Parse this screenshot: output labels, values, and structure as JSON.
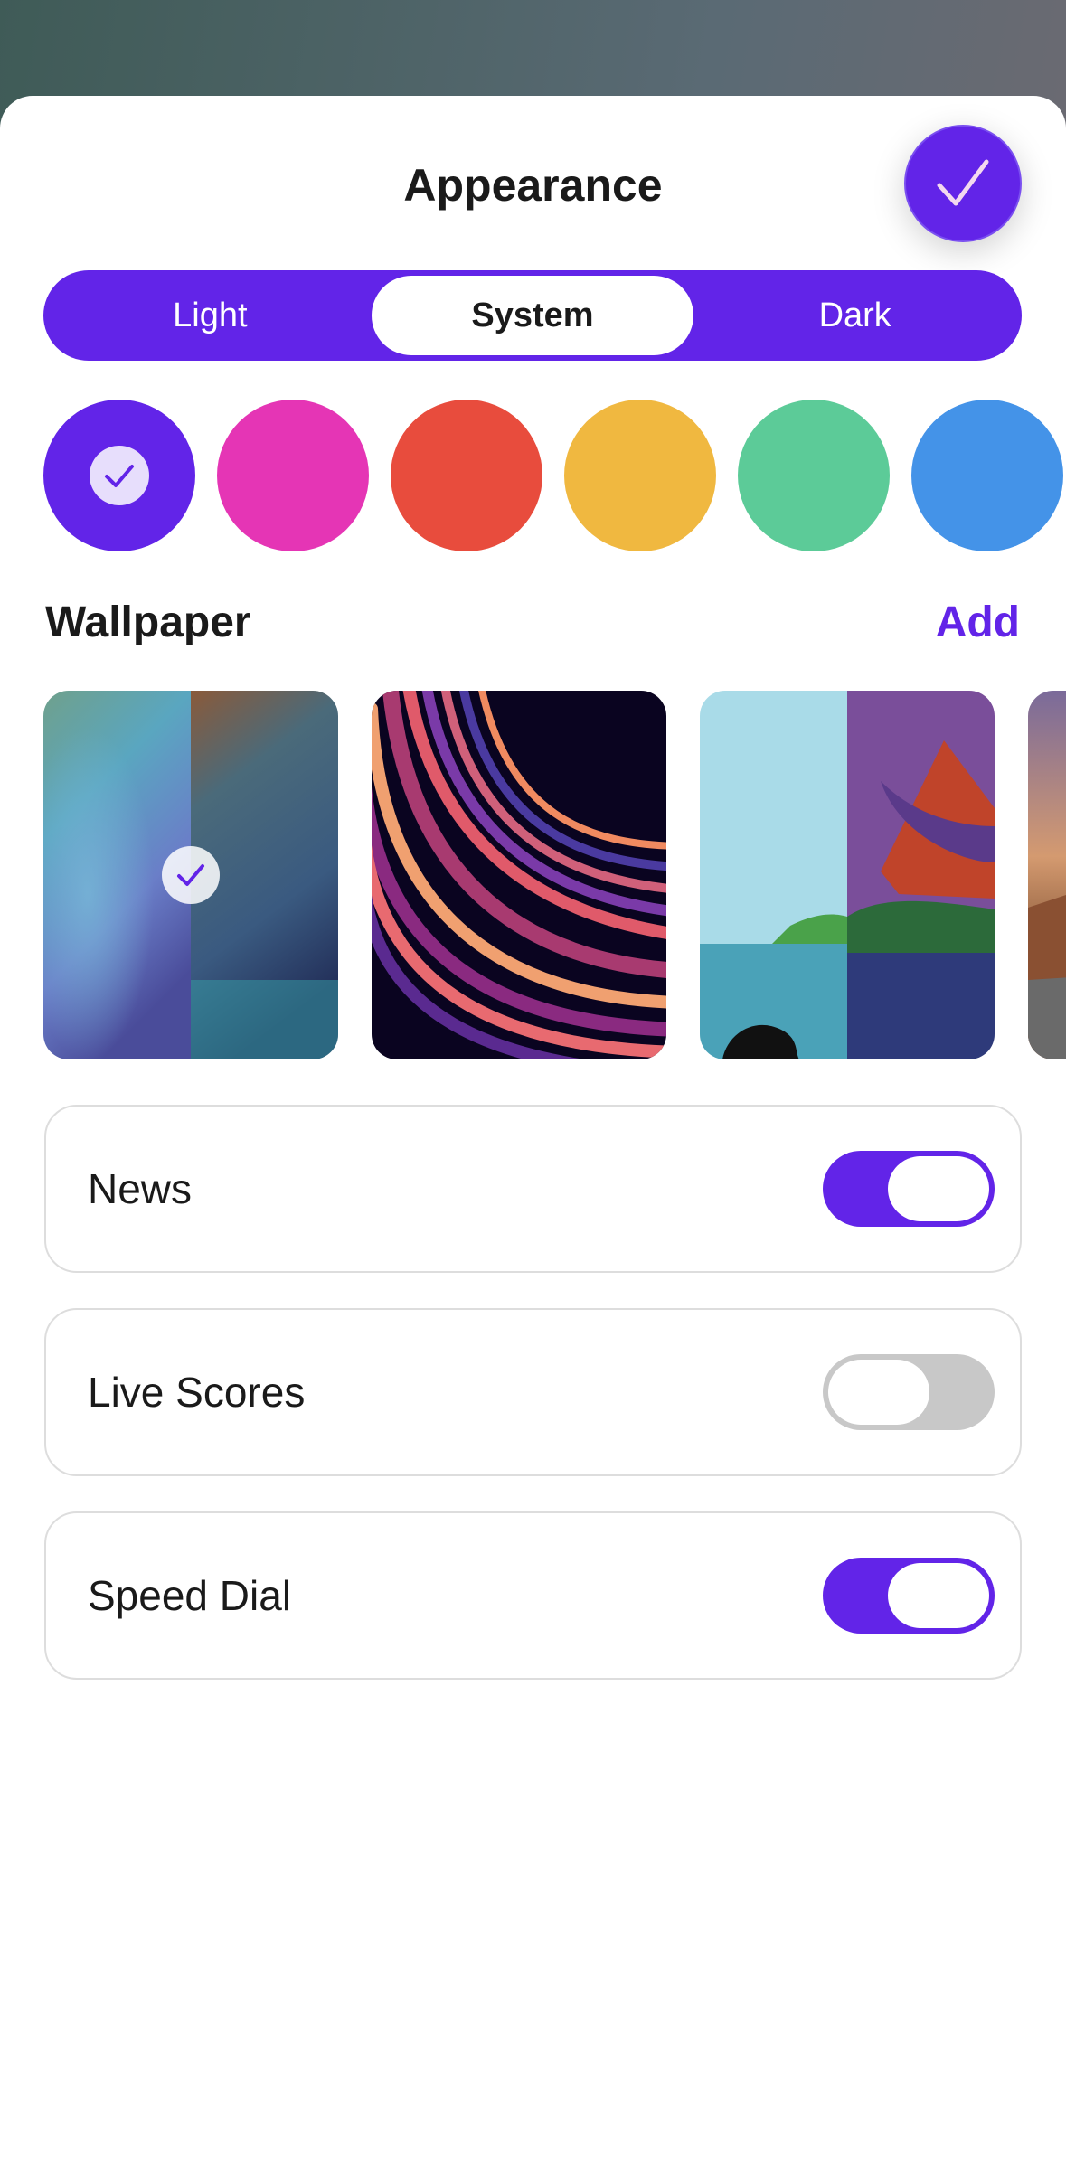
{
  "header": {
    "title": "Appearance",
    "done_icon": "checkmark-icon"
  },
  "theme": {
    "options": [
      "Light",
      "System",
      "Dark"
    ],
    "selected": "System",
    "accent": "#6224e8"
  },
  "accent_colors": [
    {
      "name": "purple",
      "hex": "#6224e8",
      "selected": true
    },
    {
      "name": "pink",
      "hex": "#e535b5",
      "selected": false
    },
    {
      "name": "red",
      "hex": "#e84c3d",
      "selected": false
    },
    {
      "name": "yellow",
      "hex": "#f0b840",
      "selected": false
    },
    {
      "name": "green",
      "hex": "#5ccb98",
      "selected": false
    },
    {
      "name": "blue",
      "hex": "#4493e8",
      "selected": false
    }
  ],
  "wallpaper": {
    "title": "Wallpaper",
    "add_label": "Add",
    "items": [
      {
        "name": "blurred-gradient",
        "selected": true
      },
      {
        "name": "neon-swirl",
        "selected": false
      },
      {
        "name": "coastal-landscape",
        "selected": false
      },
      {
        "name": "desert-road",
        "selected": false
      }
    ]
  },
  "settings": [
    {
      "label": "News",
      "on": true
    },
    {
      "label": "Live Scores",
      "on": false
    },
    {
      "label": "Speed Dial",
      "on": true
    }
  ]
}
